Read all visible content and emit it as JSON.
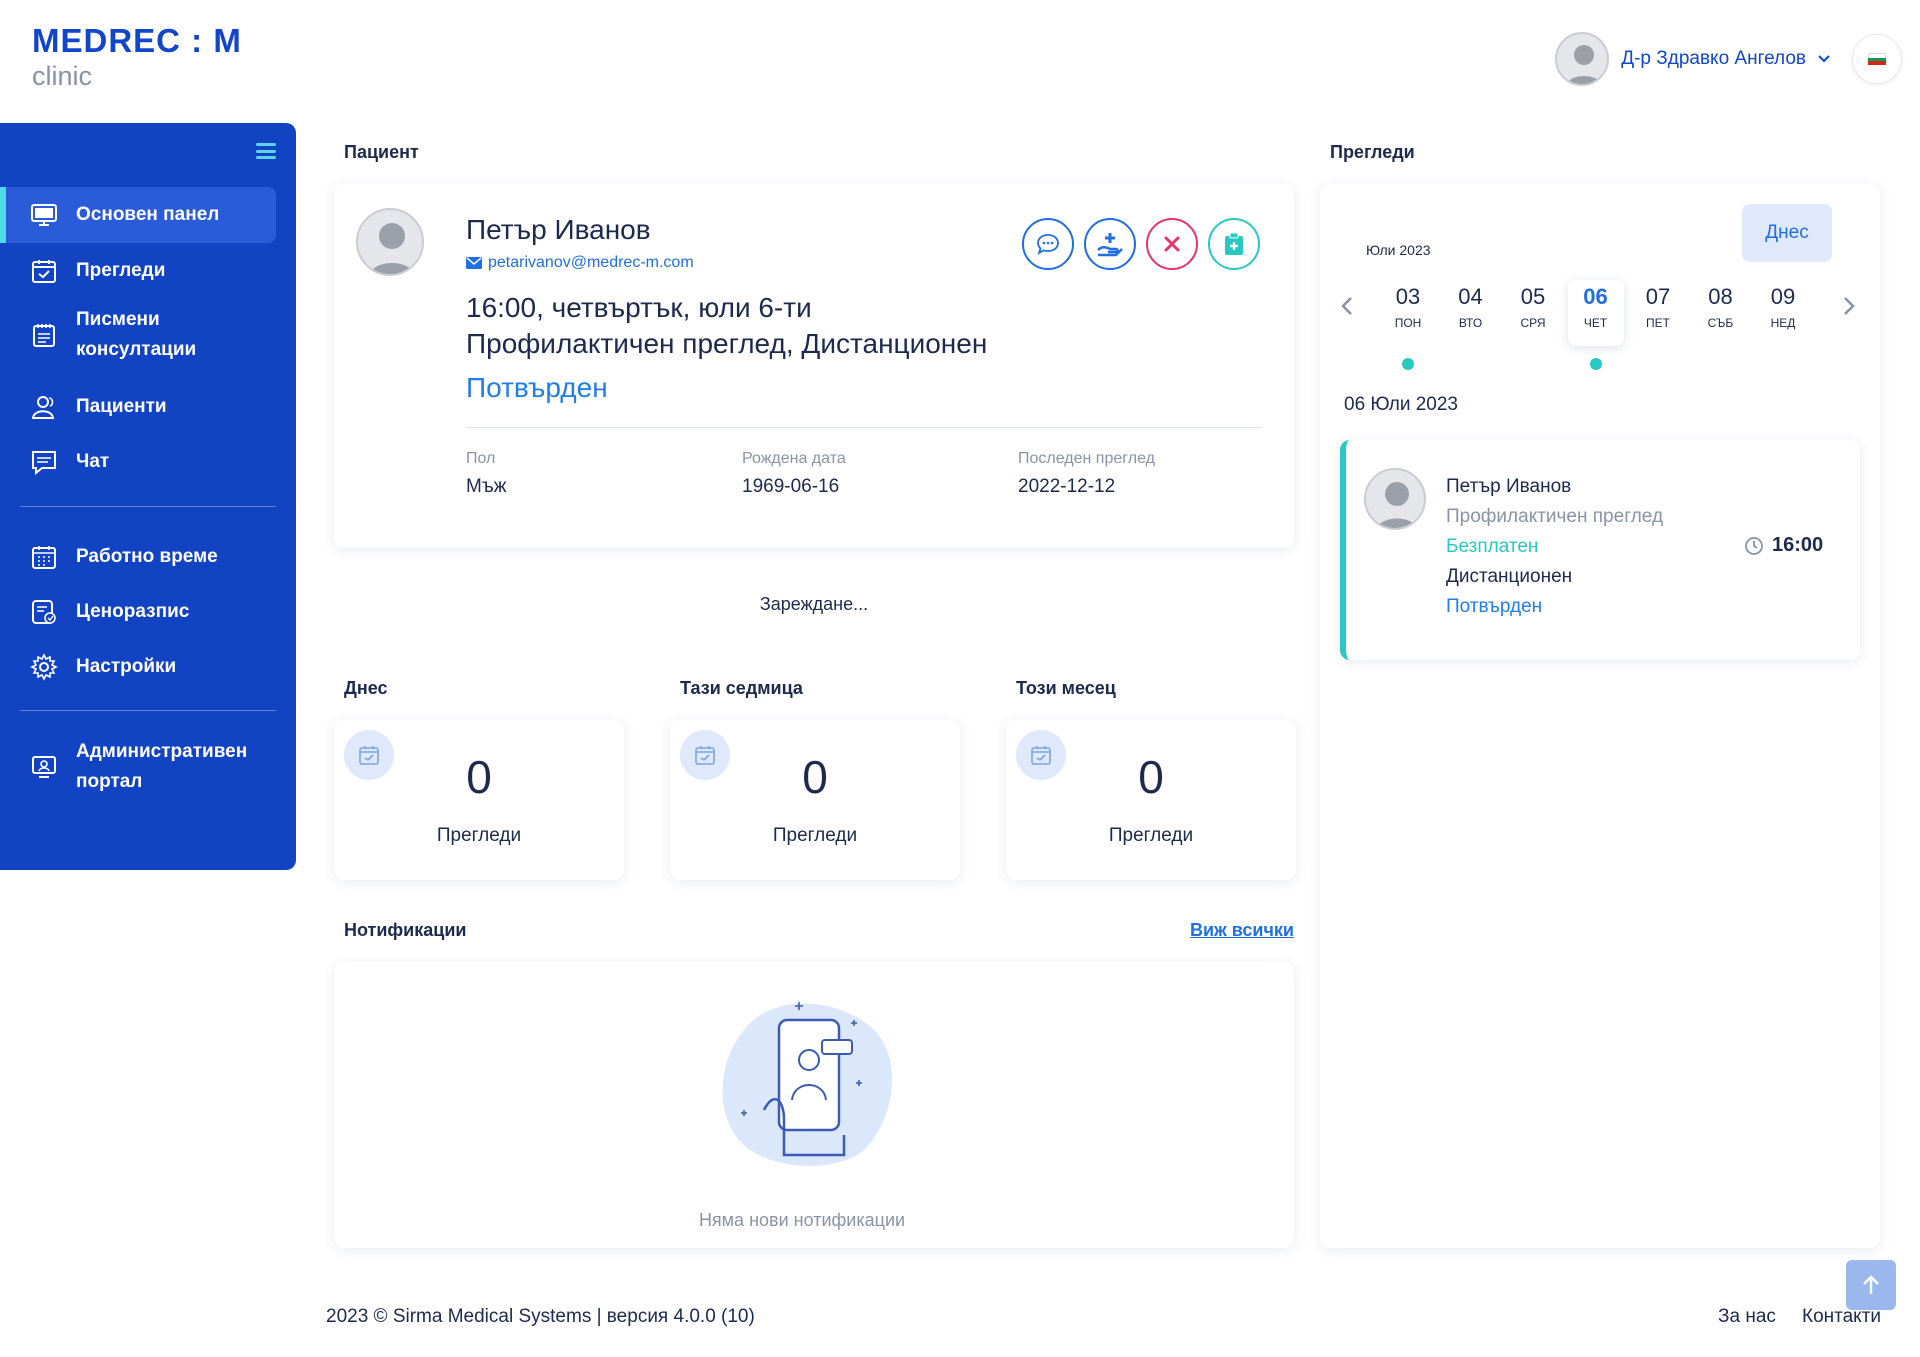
{
  "brand": {
    "name": "MEDREC : M",
    "sub": "clinic"
  },
  "user": {
    "name": "Д-р Здравко Ангелов"
  },
  "sidebar": {
    "items": [
      {
        "label": "Основен панел",
        "icon": "monitor-icon"
      },
      {
        "label": "Прегледи",
        "icon": "calendar-check-icon"
      },
      {
        "label": "Писмени консултации",
        "icon": "notepad-icon"
      },
      {
        "label": "Пациенти",
        "icon": "users-icon"
      },
      {
        "label": "Чат",
        "icon": "chat-icon"
      },
      {
        "label": "Работно време",
        "icon": "calendar-grid-icon"
      },
      {
        "label": "Ценоразпис",
        "icon": "price-list-icon"
      },
      {
        "label": "Настройки",
        "icon": "gear-icon"
      },
      {
        "label": "Административен портал",
        "icon": "admin-portal-icon"
      }
    ]
  },
  "patient": {
    "section_title": "Пациент",
    "name": "Петър Иванов",
    "email": "petarivanov@medrec-m.com",
    "appt_time": "16:00, четвъртък, юли 6-ти",
    "appt_type": "Профилактичен преглед, Дистанционен",
    "status": "Потвърден",
    "fields": [
      {
        "label": "Пол",
        "value": "Мъж"
      },
      {
        "label": "Рождена дата",
        "value": "1969-06-16"
      },
      {
        "label": "Последен преглед",
        "value": "2022-12-12"
      }
    ]
  },
  "loading_text": "Зареждане...",
  "stats": [
    {
      "title": "Днес",
      "value": "0",
      "label": "Прегледи"
    },
    {
      "title": "Тази седмица",
      "value": "0",
      "label": "Прегледи"
    },
    {
      "title": "Този месец",
      "value": "0",
      "label": "Прегледи"
    }
  ],
  "notifications": {
    "title": "Нотификации",
    "view_all": "Виж всички",
    "empty": "Няма нови нотификации"
  },
  "appointments": {
    "title": "Прегледи",
    "today_btn": "Днес",
    "month": "Юли 2023",
    "days": [
      {
        "num": "03",
        "name": "ПОН",
        "has_event": true,
        "active": false
      },
      {
        "num": "04",
        "name": "ВТО",
        "has_event": false,
        "active": false
      },
      {
        "num": "05",
        "name": "СРЯ",
        "has_event": false,
        "active": false
      },
      {
        "num": "06",
        "name": "ЧЕТ",
        "has_event": true,
        "active": true
      },
      {
        "num": "07",
        "name": "ПЕТ",
        "has_event": false,
        "active": false
      },
      {
        "num": "08",
        "name": "СЪБ",
        "has_event": false,
        "active": false
      },
      {
        "num": "09",
        "name": "НЕД",
        "has_event": false,
        "active": false
      }
    ],
    "selected_date": "06 Юли 2023",
    "card": {
      "name": "Петър Иванов",
      "type": "Профилактичен преглед",
      "price": "Безплатен",
      "mode": "Дистанционен",
      "status": "Потвърден",
      "time": "16:00"
    }
  },
  "footer": {
    "copyright": "2023 ©  Sirma Medical Systems | версия 4.0.0 (10)",
    "about": "За нас",
    "contacts": "Контакти"
  },
  "colors": {
    "sidebar": "#1143c3",
    "accent": "#1f6fe0",
    "teal": "#27c9c0",
    "danger": "#e8336d"
  }
}
